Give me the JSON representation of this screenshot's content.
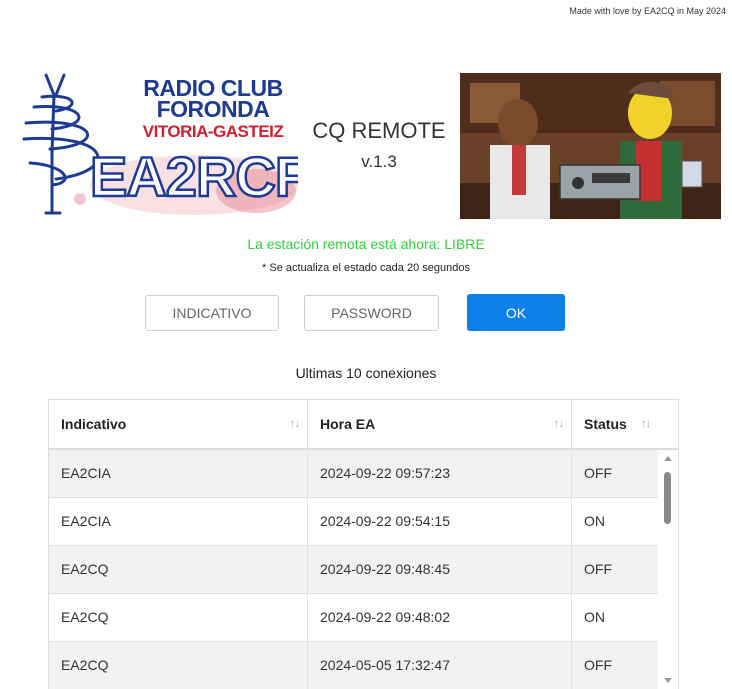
{
  "credit": "Made with love by EA2CQ in May 2024",
  "logo": {
    "line1": "RADIO CLUB",
    "line2": "FORONDA",
    "line3": "VITORIA-GASTEIZ",
    "callsign": "EA2RCF"
  },
  "app": {
    "title": "CQ REMOTE",
    "version": "v.1.3"
  },
  "status": {
    "text": "La estación remota está ahora: LIBRE",
    "color": "#2dd33a",
    "refresh_note": "* Se actualiza el estado cada 20 segundos"
  },
  "form": {
    "callsign_placeholder": "INDICATIVO",
    "password_placeholder": "PASSWORD",
    "ok_label": "OK",
    "accent": "#0d7fe8"
  },
  "connections": {
    "title": "Ultimas 10 conexiones",
    "columns": [
      "Indicativo",
      "Hora EA",
      "Status"
    ],
    "sort_icon": "sort-arrows-icon",
    "rows": [
      {
        "callsign": "EA2CIA",
        "time": "2024-09-22 09:57:23",
        "status": "OFF"
      },
      {
        "callsign": "EA2CIA",
        "time": "2024-09-22 09:54:15",
        "status": "ON"
      },
      {
        "callsign": "EA2CQ",
        "time": "2024-09-22 09:48:45",
        "status": "OFF"
      },
      {
        "callsign": "EA2CQ",
        "time": "2024-09-22 09:48:02",
        "status": "ON"
      },
      {
        "callsign": "EA2CQ",
        "time": "2024-05-05 17:32:47",
        "status": "OFF"
      }
    ]
  }
}
